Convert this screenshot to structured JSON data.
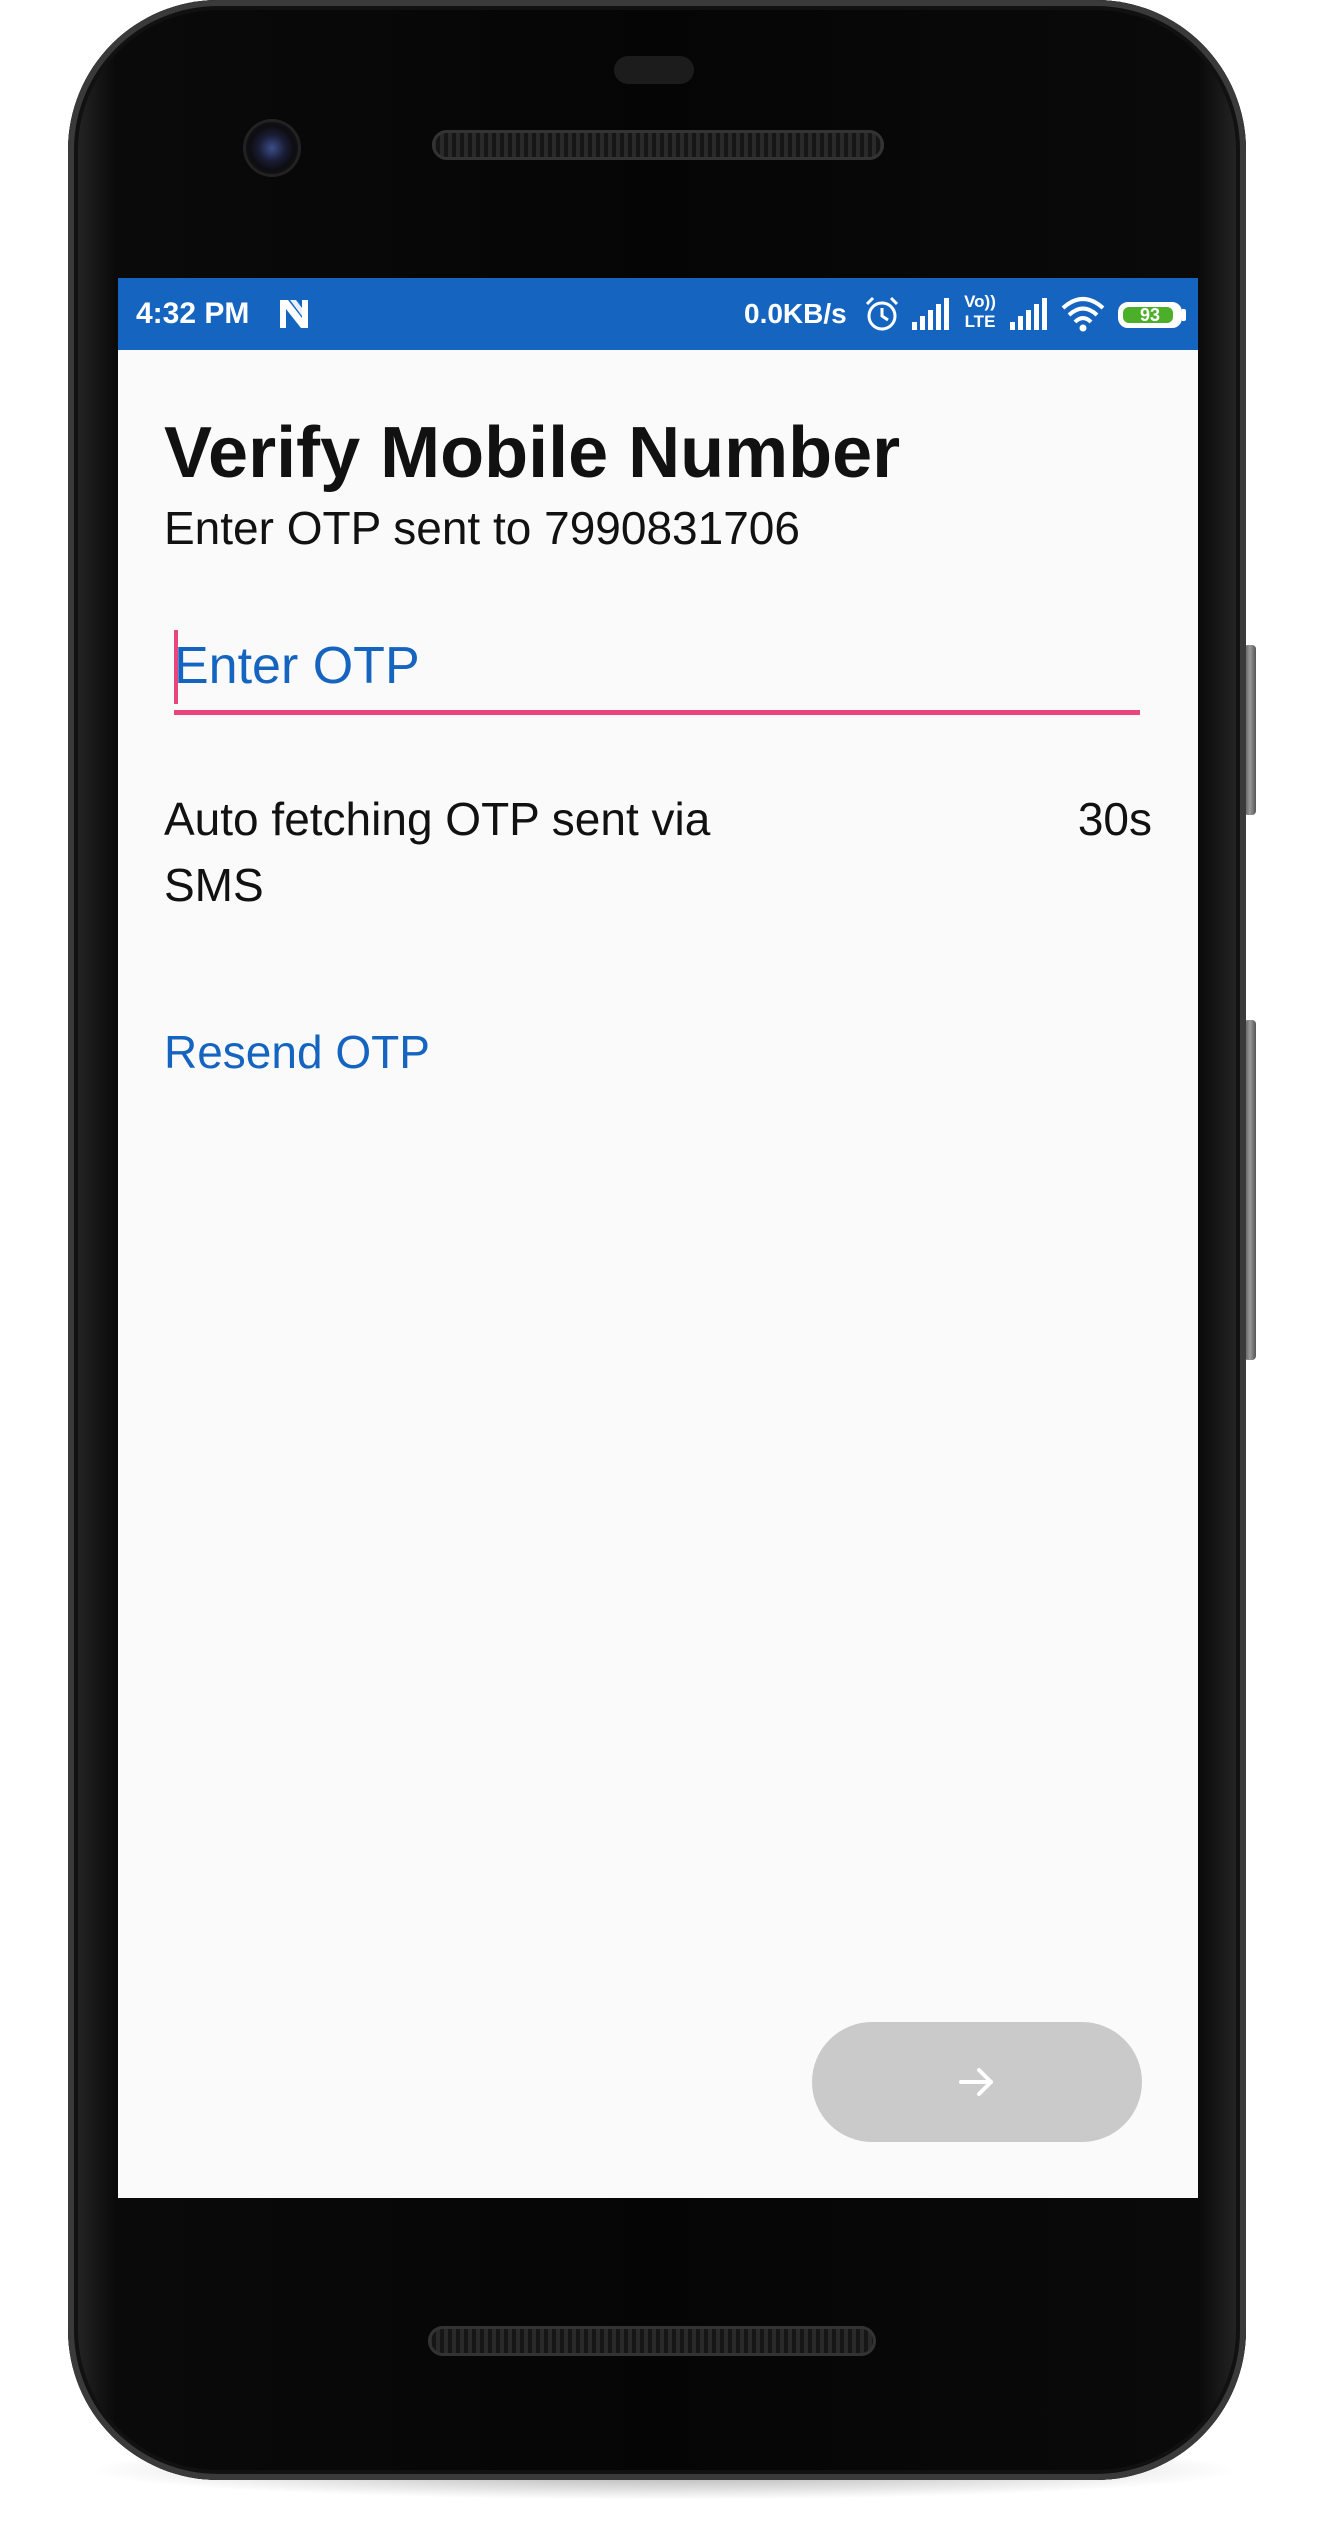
{
  "status_bar": {
    "time": "4:32 PM",
    "network_speed": "0.0KB/s",
    "volte_label_top": "Vo))",
    "volte_label_bottom": "LTE",
    "battery_level": 93,
    "battery_label": "93",
    "background_color": "#1565c0",
    "icons": [
      "notification-n-icon",
      "alarm-icon",
      "signal-icon",
      "volte-icon",
      "signal-icon",
      "wifi-icon",
      "battery-icon"
    ]
  },
  "header": {
    "title": "Verify Mobile Number",
    "subtitle": "Enter OTP sent to 7990831706"
  },
  "otp_input": {
    "value": "",
    "placeholder": "Enter OTP",
    "accent_color": "#e8467c"
  },
  "auto_fetch": {
    "message": "Auto fetching OTP sent via SMS",
    "countdown": "30s"
  },
  "resend": {
    "label": "Resend OTP",
    "color": "#1565c0"
  },
  "next_button": {
    "icon": "arrow-right-icon",
    "state": "disabled",
    "color": "#cacaca"
  }
}
